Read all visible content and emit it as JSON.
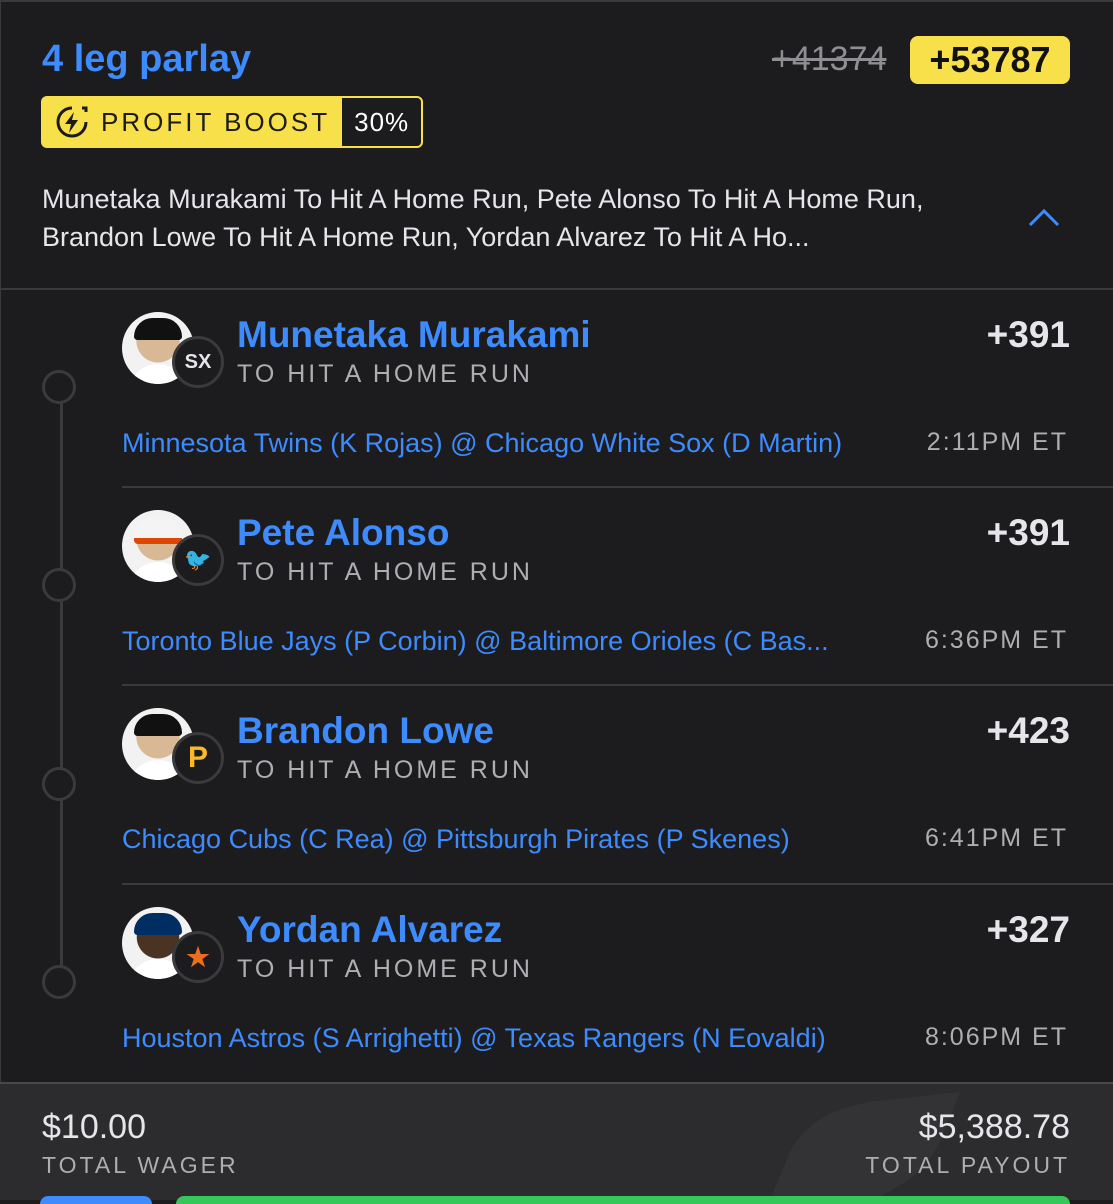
{
  "header": {
    "title": "4 leg parlay",
    "odds_original": "+41374",
    "odds_boosted": "+53787",
    "boost": {
      "label": "PROFIT BOOST",
      "percent": "30%",
      "icon": "lightning-bolt-icon",
      "color": "#f8e04a"
    },
    "summary": "Munetaka Murakami To Hit A Home Run, Pete Alonso To Hit A Home Run, Brandon Lowe To Hit A Home Run, Yordan Alvarez To Hit A Ho...",
    "collapse_icon": "chevron-up-icon"
  },
  "legs": [
    {
      "player": "Munetaka Murakami",
      "market": "TO HIT A HOME RUN",
      "odds": "+391",
      "game": "Minnesota Twins (K Rojas) @ Chicago White Sox (D Martin)",
      "time": "2:11PM ET",
      "team_logo": "SX",
      "team_color": "#e5e5ea"
    },
    {
      "player": "Pete Alonso",
      "market": "TO HIT A HOME RUN",
      "odds": "+391",
      "game": "Toronto Blue Jays (P Corbin) @ Baltimore Orioles (C Bas...",
      "time": "6:36PM ET",
      "team_logo": "🐦",
      "team_color": "#df4601"
    },
    {
      "player": "Brandon Lowe",
      "market": "TO HIT A HOME RUN",
      "odds": "+423",
      "game": "Chicago Cubs (C Rea) @ Pittsburgh Pirates (P Skenes)",
      "time": "6:41PM ET",
      "team_logo": "P",
      "team_color": "#fdb827"
    },
    {
      "player": "Yordan Alvarez",
      "market": "TO HIT A HOME RUN",
      "odds": "+327",
      "game": "Houston Astros (S Arrighetti) @ Texas Rangers (N Eovaldi)",
      "time": "8:06PM ET",
      "team_logo": "★",
      "team_color": "#eb6e1f"
    }
  ],
  "footer": {
    "wager_value": "$10.00",
    "wager_label": "TOTAL WAGER",
    "payout_value": "$5,388.78",
    "payout_label": "TOTAL PAYOUT"
  },
  "colors": {
    "accent": "#3d8bfd",
    "background": "#1c1c1e",
    "boost": "#f8e04a"
  }
}
